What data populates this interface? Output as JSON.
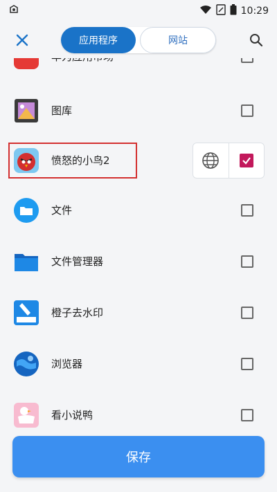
{
  "status_bar": {
    "time": "10:29"
  },
  "header": {
    "tabs": [
      {
        "label": "应用程序",
        "active": true
      },
      {
        "label": "网站",
        "active": false
      }
    ]
  },
  "apps": [
    {
      "label": "华为应用市场",
      "icon": "app-market-icon",
      "checked": false
    },
    {
      "label": "图库",
      "icon": "gallery-icon",
      "checked": false
    },
    {
      "label": "愤怒的小鸟2",
      "icon": "angry-birds-icon",
      "checked": true
    },
    {
      "label": "文件",
      "icon": "files-icon",
      "checked": false
    },
    {
      "label": "文件管理器",
      "icon": "file-manager-icon",
      "checked": false
    },
    {
      "label": "橙子去水印",
      "icon": "watermark-remover-icon",
      "checked": false
    },
    {
      "label": "浏览器",
      "icon": "browser-icon",
      "checked": false
    },
    {
      "label": "看小说鸭",
      "icon": "novel-duck-icon",
      "checked": false
    }
  ],
  "save_label": "保存",
  "colors": {
    "accent": "#1a73c8",
    "save": "#3b8ff0",
    "checked": "#c2185b",
    "highlight": "#d32f2f"
  }
}
